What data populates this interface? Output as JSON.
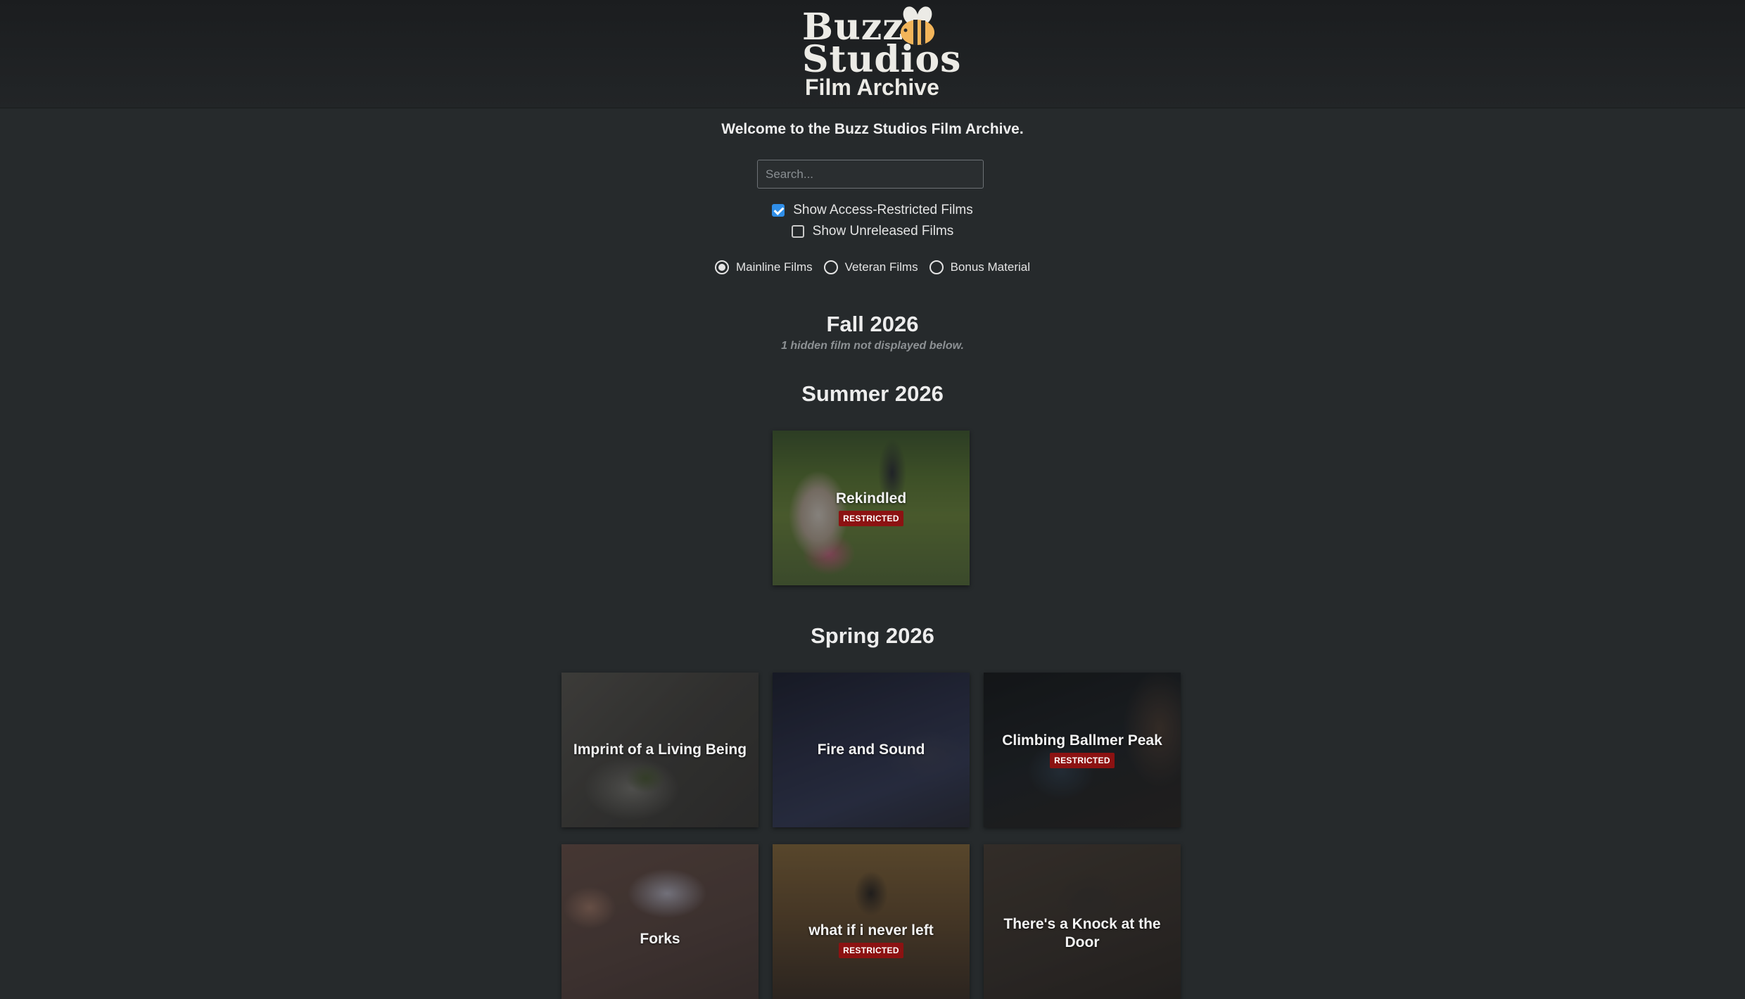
{
  "header": {
    "logo_line1": "Buzz",
    "logo_line2": "Studios",
    "logo_line3": "Film Archive"
  },
  "welcome": "Welcome to the Buzz Studios Film Archive.",
  "search": {
    "placeholder": "Search...",
    "value": ""
  },
  "filters": {
    "show_restricted": {
      "label": "Show Access-Restricted Films",
      "checked": true
    },
    "show_unreleased": {
      "label": "Show Unreleased Films",
      "checked": false
    }
  },
  "categories": [
    {
      "label": "Mainline Films",
      "selected": true
    },
    {
      "label": "Veteran Films",
      "selected": false
    },
    {
      "label": "Bonus Material",
      "selected": false
    }
  ],
  "sections": [
    {
      "title": "Fall 2026",
      "note": "1 hidden film not displayed below."
    },
    {
      "title": "Summer 2026",
      "films": [
        {
          "title": "Rekindled",
          "badge": "RESTRICTED"
        }
      ]
    },
    {
      "title": "Spring 2026",
      "films": [
        {
          "title": "Imprint of a Living Being"
        },
        {
          "title": "Fire and Sound"
        },
        {
          "title": "Climbing Ballmer Peak",
          "badge": "RESTRICTED"
        },
        {
          "title": "Forks"
        },
        {
          "title": "what if i never left",
          "badge": "RESTRICTED"
        },
        {
          "title": "There's a Knock at the Door"
        }
      ]
    }
  ],
  "colors": {
    "background": "#262a2c",
    "header": "#1d2022",
    "accent_checkbox": "#2f8ee8",
    "restricted_badge": "#8c1212"
  }
}
